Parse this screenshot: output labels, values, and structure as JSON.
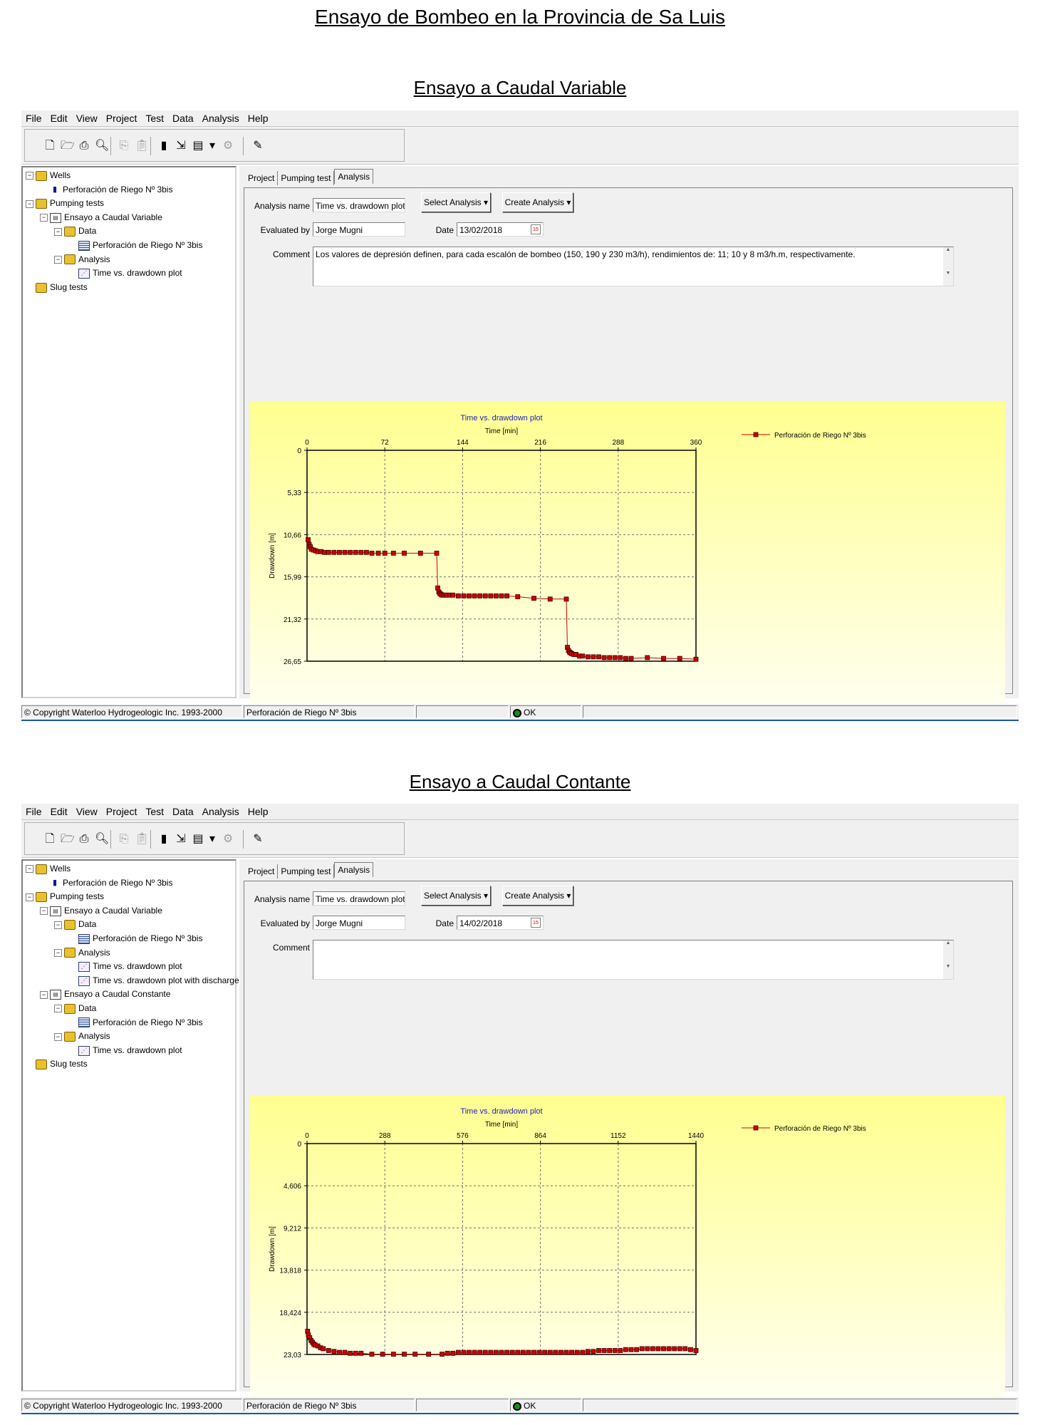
{
  "page_title": "Ensayo de Bombeo en la Provincia de Sa Luis",
  "menu": [
    "File",
    "Edit",
    "View",
    "Project",
    "Test",
    "Data",
    "Analysis",
    "Help"
  ],
  "toolbar_icons": [
    "new-file-icon",
    "open-folder-icon",
    "print-icon",
    "print-preview-icon",
    "copy-icon",
    "paste-icon",
    "well-icon",
    "import-icon",
    "report-icon",
    "dropdown-arrow-icon",
    "settings-icon",
    "wizard-icon"
  ],
  "labels": {
    "analysis_name": "Analysis name",
    "evaluated_by": "Evaluated by",
    "date": "Date",
    "comment": "Comment",
    "select_analysis": "Select Analysis",
    "create_analysis": "Create Analysis",
    "tabs": [
      "Project",
      "Pumping test",
      "Analysis"
    ]
  },
  "status": {
    "copyright": "© Copyright Waterloo Hydrogeologic Inc. 1993-2000",
    "well": "Perforación de Riego Nº 3bis",
    "ok": "OK"
  },
  "sections": [
    {
      "heading": "Ensayo a Caudal Variable",
      "tree": [
        {
          "label": "Wells",
          "icon": "folder",
          "level": 0,
          "expander": "−"
        },
        {
          "label": "Perforación de Riego Nº 3bis",
          "icon": "well",
          "level": 1
        },
        {
          "label": "Pumping tests",
          "icon": "folder",
          "level": 0,
          "expander": "−"
        },
        {
          "label": "Ensayo a Caudal Variable",
          "icon": "doc",
          "level": 1,
          "expander": "−"
        },
        {
          "label": "Data",
          "icon": "folder",
          "level": 2,
          "expander": "−"
        },
        {
          "label": "Perforación de Riego Nº 3bis",
          "icon": "table",
          "level": 3
        },
        {
          "label": "Analysis",
          "icon": "folder",
          "level": 2,
          "expander": "−"
        },
        {
          "label": "Time vs. drawdown plot",
          "icon": "plot",
          "level": 3
        },
        {
          "label": "Slug tests",
          "icon": "folder",
          "level": 0
        }
      ],
      "form": {
        "analysis_name": "Time vs. drawdown plot",
        "evaluated_by": "Jorge Mugni",
        "date": "13/02/2018",
        "comment": "Los valores de depresión definen, para cada escalón de bombeo (150, 190 y 230 m3/h), rendimientos de: 11; 10 y 8 m3/h.m, respectivamente."
      },
      "chart_data": {
        "type": "line",
        "title": "Time vs. drawdown plot",
        "xlabel": "Time [min]",
        "ylabel": "Drawdown [m]",
        "x_ticks": [
          "0",
          "72",
          "144",
          "216",
          "288",
          "360"
        ],
        "y_ticks": [
          "0",
          "5,33",
          "10,66",
          "15,99",
          "21,32",
          "26,65"
        ],
        "xlim": [
          0,
          360
        ],
        "ylim": [
          0,
          26.65
        ],
        "y_inverted": true,
        "grid": true,
        "legend_position": "top-right",
        "series": [
          {
            "name": "Perforación de Riego Nº 3bis",
            "color": "#cc0000",
            "x": [
              1,
              2,
              3,
              4,
              6,
              8,
              10,
              13,
              16,
              20,
              25,
              30,
              35,
              40,
              45,
              50,
              55,
              60,
              66,
              72,
              80,
              90,
              105,
              120,
              121,
              122,
              123,
              124,
              125,
              127,
              129,
              132,
              135,
              140,
              145,
              150,
              155,
              160,
              165,
              170,
              175,
              180,
              185,
              195,
              210,
              225,
              240,
              241,
              242,
              243,
              244,
              245,
              247,
              249,
              252,
              255,
              260,
              265,
              270,
              275,
              280,
              285,
              290,
              295,
              300,
              315,
              330,
              345,
              360
            ],
            "y": [
              11.3,
              11.9,
              12.2,
              12.5,
              12.6,
              12.7,
              12.8,
              12.8,
              12.9,
              12.9,
              12.9,
              12.9,
              12.9,
              12.9,
              12.9,
              12.9,
              12.9,
              13.0,
              13.0,
              13.0,
              13.0,
              13.0,
              13.0,
              13.0,
              17.4,
              17.9,
              18.1,
              18.2,
              18.3,
              18.3,
              18.3,
              18.3,
              18.3,
              18.4,
              18.4,
              18.4,
              18.4,
              18.4,
              18.4,
              18.4,
              18.4,
              18.4,
              18.4,
              18.5,
              18.7,
              18.8,
              18.8,
              24.9,
              25.3,
              25.5,
              25.6,
              25.7,
              25.8,
              25.8,
              26.0,
              26.0,
              26.1,
              26.1,
              26.1,
              26.2,
              26.2,
              26.2,
              26.2,
              26.3,
              26.3,
              26.2,
              26.3,
              26.3,
              26.4
            ]
          }
        ]
      }
    },
    {
      "heading": "Ensayo a Caudal Contante",
      "tree": [
        {
          "label": "Wells",
          "icon": "folder",
          "level": 0,
          "expander": "−"
        },
        {
          "label": "Perforación de Riego Nº 3bis",
          "icon": "well",
          "level": 1
        },
        {
          "label": "Pumping tests",
          "icon": "folder",
          "level": 0,
          "expander": "−"
        },
        {
          "label": "Ensayo a Caudal Variable",
          "icon": "doc",
          "level": 1,
          "expander": "−"
        },
        {
          "label": "Data",
          "icon": "folder",
          "level": 2,
          "expander": "−"
        },
        {
          "label": "Perforación de Riego Nº 3bis",
          "icon": "table",
          "level": 3
        },
        {
          "label": "Analysis",
          "icon": "folder",
          "level": 2,
          "expander": "−"
        },
        {
          "label": "Time vs. drawdown plot",
          "icon": "plot",
          "level": 3
        },
        {
          "label": "Time vs. drawdown plot with discharge",
          "icon": "plot",
          "level": 3
        },
        {
          "label": "Ensayo a Caudal Constante",
          "icon": "doc",
          "level": 1,
          "expander": "−"
        },
        {
          "label": "Data",
          "icon": "folder",
          "level": 2,
          "expander": "−"
        },
        {
          "label": "Perforación de Riego Nº 3bis",
          "icon": "table",
          "level": 3
        },
        {
          "label": "Analysis",
          "icon": "folder",
          "level": 2,
          "expander": "−"
        },
        {
          "label": "Time vs. drawdown plot",
          "icon": "plot",
          "level": 3
        },
        {
          "label": "Slug tests",
          "icon": "folder",
          "level": 0
        }
      ],
      "form": {
        "analysis_name": "Time vs. drawdown plot",
        "evaluated_by": "Jorge Mugni",
        "date": "14/02/2018",
        "comment": ""
      },
      "chart_data": {
        "type": "line",
        "title": "Time vs. drawdown plot",
        "xlabel": "Time [min]",
        "ylabel": "Drawdown [m]",
        "x_ticks": [
          "0",
          "288",
          "576",
          "864",
          "1152",
          "1440"
        ],
        "y_ticks": [
          "0",
          "4,606",
          "9,212",
          "13,818",
          "18,424",
          "23,03"
        ],
        "xlim": [
          0,
          1440
        ],
        "ylim": [
          0,
          23.03
        ],
        "y_inverted": true,
        "grid": true,
        "legend_position": "top-right",
        "series": [
          {
            "name": "Perforación de Riego Nº 3bis",
            "color": "#cc0000",
            "x": [
              2,
              5,
              10,
              15,
              20,
              25,
              30,
              40,
              50,
              60,
              80,
              100,
              120,
              140,
              160,
              180,
              200,
              240,
              280,
              320,
              360,
              400,
              450,
              500,
              520,
              540,
              560,
              580,
              600,
              620,
              640,
              660,
              680,
              700,
              720,
              740,
              760,
              780,
              800,
              820,
              840,
              860,
              880,
              900,
              920,
              940,
              960,
              980,
              1000,
              1020,
              1040,
              1060,
              1080,
              1100,
              1120,
              1140,
              1160,
              1180,
              1200,
              1220,
              1240,
              1260,
              1280,
              1300,
              1320,
              1340,
              1360,
              1380,
              1400,
              1420,
              1440
            ],
            "y": [
              20.5,
              20.9,
              21.2,
              21.5,
              21.7,
              21.9,
              22.0,
              22.1,
              22.3,
              22.4,
              22.6,
              22.7,
              22.8,
              22.8,
              22.9,
              22.9,
              22.9,
              23.0,
              23.0,
              23.0,
              23.0,
              23.0,
              23.0,
              23.0,
              22.9,
              22.9,
              22.8,
              22.8,
              22.8,
              22.8,
              22.8,
              22.8,
              22.8,
              22.8,
              22.8,
              22.8,
              22.8,
              22.8,
              22.8,
              22.8,
              22.8,
              22.8,
              22.8,
              22.8,
              22.8,
              22.8,
              22.8,
              22.8,
              22.8,
              22.8,
              22.7,
              22.7,
              22.6,
              22.6,
              22.6,
              22.6,
              22.6,
              22.5,
              22.5,
              22.5,
              22.4,
              22.4,
              22.4,
              22.4,
              22.4,
              22.4,
              22.4,
              22.4,
              22.4,
              22.5,
              22.6
            ]
          }
        ]
      }
    }
  ]
}
